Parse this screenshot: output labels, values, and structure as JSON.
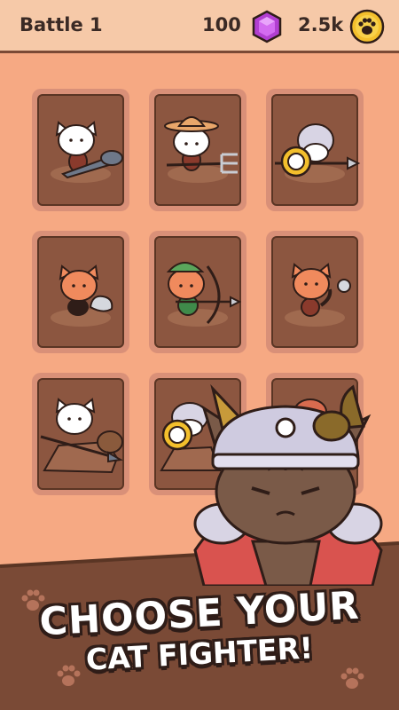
{
  "header": {
    "title": "Battle 1",
    "gems": "100",
    "coins": "2.5k",
    "gem_icon": "purple-gem-icon",
    "coin_icon": "paw-coin-icon"
  },
  "colors": {
    "background": "#f6a983",
    "header_bg": "#f6c9a8",
    "card_frame": "#d99078",
    "card_fill": "#8c5640",
    "ground": "#7a4a36",
    "gem": "#b23fd1",
    "coin": "#f3bf2c",
    "outline": "#2f1d18"
  },
  "fighters": [
    {
      "name": "club cat",
      "icon": "club-cat-icon"
    },
    {
      "name": "farmer cat",
      "icon": "pitchfork-cat-icon"
    },
    {
      "name": "knight cat",
      "icon": "shield-spear-knight-cat-icon"
    },
    {
      "name": "rock cat",
      "icon": "rock-cat-icon"
    },
    {
      "name": "archer cat",
      "icon": "archer-cat-icon"
    },
    {
      "name": "thrower cat",
      "icon": "stone-thrower-cat-icon"
    },
    {
      "name": "rider cat",
      "icon": "dog-rider-cat-icon"
    },
    {
      "name": "shield cat",
      "icon": "shield-cat-icon"
    },
    {
      "name": "locked",
      "icon": "hidden-fighter-icon"
    }
  ],
  "mascot": {
    "icon": "viking-cat-mascot-icon"
  },
  "headline": {
    "line1": "CHOOSE YOUR",
    "line2": "CAT FIGHTER!"
  }
}
